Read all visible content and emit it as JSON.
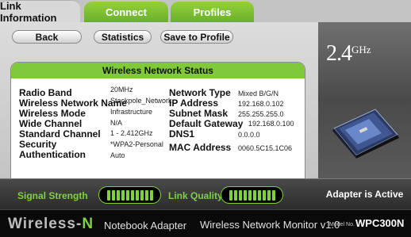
{
  "tabs": [
    {
      "label": "Link Information",
      "active": true
    },
    {
      "label": "Connect",
      "active": false
    },
    {
      "label": "Profiles",
      "active": false
    }
  ],
  "toolbar": {
    "back_label": "Back",
    "statistics_label": "Statistics",
    "save_label": "Save to Profile"
  },
  "status": {
    "title": "Wireless Network Status",
    "left_fields": [
      {
        "label": "Radio Band",
        "value": "20MHz"
      },
      {
        "label": "Wireless Network Name",
        "value": "Stackpole_Network"
      },
      {
        "label": "Wireless Mode",
        "value": "Infrastructure"
      },
      {
        "label": "Wide Channel",
        "value": "N/A"
      },
      {
        "label": "Standard Channel",
        "value": "1 - 2.412GHz"
      },
      {
        "label": "Security",
        "value": "*WPA2-Personal"
      },
      {
        "label": "Authentication",
        "value": "Auto"
      }
    ],
    "right_fields": [
      {
        "label": "Network Type",
        "value": "Mixed B/G/N"
      },
      {
        "label": "IP Address",
        "value": "192.168.0.102"
      },
      {
        "label": "Subnet Mask",
        "value": "255.255.255.0"
      },
      {
        "label": "Default Gateway",
        "value": "192.168.0.100"
      },
      {
        "label": "DNS1",
        "value": "0.0.0.0"
      },
      {
        "label": "MAC Address",
        "value": "0060.5C15.1C06"
      }
    ]
  },
  "badge": {
    "ghz_number": "2.4",
    "ghz_unit": "GHz"
  },
  "signal": {
    "signal_label": "Signal Strength",
    "link_label": "Link Quality",
    "signal_bars": 10,
    "link_bars": 10,
    "active_text": "Adapter is Active"
  },
  "footer": {
    "brand_word": "Wireless-",
    "brand_n": "N",
    "brand_sub": "Notebook Adapter",
    "monitor": "Wireless Network Monitor  v1.0",
    "model_prefix": "Model No.",
    "model": "WPC300N"
  },
  "colors": {
    "accent_green": "#7fc93b",
    "dark": "#0a0a0a"
  }
}
